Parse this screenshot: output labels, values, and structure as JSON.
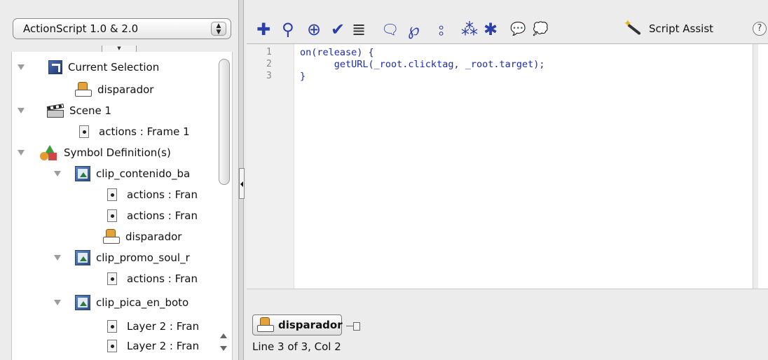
{
  "left_panel": {
    "language_select": {
      "value": "ActionScript 1.0 & 2.0"
    },
    "tree": [
      {
        "label": "Current Selection",
        "icon": "current-selection-icon"
      },
      {
        "label": "disparador",
        "icon": "button-symbol-icon"
      },
      {
        "label": "Scene 1",
        "icon": "scene-clapper-icon"
      },
      {
        "label": "actions : Frame 1",
        "icon": "frame-icon"
      },
      {
        "label": "Symbol Definition(s)",
        "icon": "symbol-definitions-icon"
      },
      {
        "label": "clip_contenido_ba",
        "icon": "movieclip-icon"
      },
      {
        "label": "actions : Fran",
        "icon": "frame-icon"
      },
      {
        "label": "actions : Fran",
        "icon": "frame-icon"
      },
      {
        "label": "disparador",
        "icon": "button-symbol-icon"
      },
      {
        "label": "clip_promo_soul_r",
        "icon": "movieclip-icon"
      },
      {
        "label": "actions : Fran",
        "icon": "frame-icon"
      },
      {
        "label": "clip_pica_en_boto",
        "icon": "movieclip-icon"
      },
      {
        "label": "Layer 2 : Fran",
        "icon": "frame-icon"
      },
      {
        "label": "Layer 2 : Fran",
        "icon": "frame-icon"
      }
    ]
  },
  "toolbar": {
    "icons": [
      {
        "name": "add-statement-icon",
        "glyph": "✚"
      },
      {
        "name": "find-icon",
        "glyph": "⚲"
      },
      {
        "name": "insert-target-path-icon",
        "glyph": "⊕"
      },
      {
        "name": "check-syntax-icon",
        "glyph": "✔"
      },
      {
        "name": "auto-format-icon",
        "glyph": "≣"
      },
      {
        "name": "show-code-hint-icon",
        "glyph": "🗨"
      },
      {
        "name": "debug-options-icon",
        "glyph": "℘"
      },
      {
        "name": "collapse-between-braces-icon",
        "glyph": "⦂"
      },
      {
        "name": "collapse-selection-icon",
        "glyph": "⁂"
      },
      {
        "name": "expand-all-icon",
        "glyph": "✱"
      },
      {
        "name": "apply-block-comment-icon",
        "glyph": "💬"
      },
      {
        "name": "apply-line-comment-icon",
        "glyph": "💭"
      }
    ],
    "script_assist_label": "Script Assist",
    "help_glyph": "?"
  },
  "editor": {
    "line_numbers": [
      "1",
      "2",
      "3"
    ],
    "code_lines": [
      "on(release) {",
      "      getURL(_root.clicktag, _root.target);",
      "}"
    ]
  },
  "bottom_bar": {
    "script_tab_label": "disparador",
    "status": "Line 3 of 3, Col 2"
  }
}
